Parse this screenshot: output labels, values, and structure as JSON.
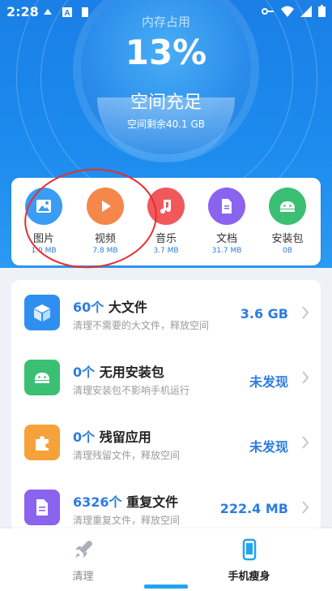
{
  "status_bar": {
    "time": "2:28"
  },
  "hero": {
    "memory_label": "内存占用",
    "percent": "13%",
    "status": "空间充足",
    "remaining": "空间剩余40.1 GB"
  },
  "categories": [
    {
      "name": "图片",
      "size": "1.0 MB",
      "icon": "image-icon",
      "color": "#3a9cf4"
    },
    {
      "name": "视频",
      "size": "7.8 MB",
      "icon": "play-icon",
      "color": "#f5874a"
    },
    {
      "name": "音乐",
      "size": "3.7 MB",
      "icon": "music-icon",
      "color": "#f0585c"
    },
    {
      "name": "文档",
      "size": "31.7 MB",
      "icon": "document-icon",
      "color": "#8a63ee"
    },
    {
      "name": "安装包",
      "size": "0B",
      "icon": "android-icon",
      "color": "#3bbf73"
    }
  ],
  "items": [
    {
      "count": "60个",
      "name": " 大文件",
      "desc": "清理不需要的大文件，释放空间",
      "value": "3.6 GB",
      "icon": "cube-icon",
      "color": "#2f8ff0"
    },
    {
      "count": "0个",
      "name": " 无用安装包",
      "desc": "清理安装包不影响手机运行",
      "value": "未发现",
      "icon": "android-icon",
      "color": "#3bbf73"
    },
    {
      "count": "0个",
      "name": " 残留应用",
      "desc": "清理残留文件，释放空间",
      "value": "未发现",
      "icon": "puzzle-icon",
      "color": "#f6a23a"
    },
    {
      "count": "6326个",
      "name": " 重复文件",
      "desc": "清理重复文件，释放空间",
      "value": "222.4 MB",
      "icon": "document-icon",
      "color": "#8a63ee"
    }
  ],
  "nav": [
    {
      "label": "清理",
      "icon": "rocket-icon"
    },
    {
      "label": "手机瘦身",
      "icon": "phone-icon"
    }
  ]
}
